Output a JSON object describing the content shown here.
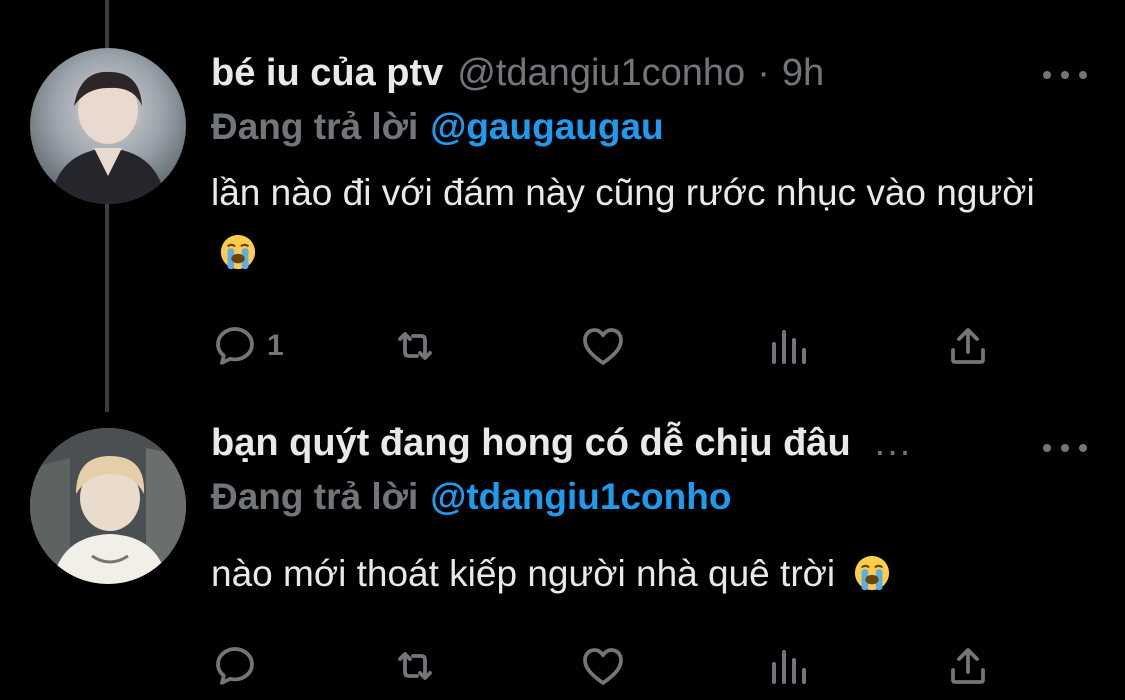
{
  "tweets": [
    {
      "display_name": "bé iu của ptv",
      "handle": "@tdangiu1conho",
      "separator": "·",
      "time": "9h",
      "reply_label": "Đang trả lời",
      "reply_to": "@gaugaugau",
      "text": "lần nào đi với đám này cũng rước nhục vào người",
      "text_emoji": "loudly-crying-face",
      "reply_count": "1"
    },
    {
      "display_name": "bạn quýt đang hong có dễ chịu đâu",
      "truncation": "...",
      "reply_label": "Đang trả lời",
      "reply_to": "@tdangiu1conho",
      "text": "nào mới thoát kiếp người nhà quê trời",
      "text_emoji": "loudly-crying-face"
    }
  ],
  "colors": {
    "background": "#000000",
    "text": "#e7e9ea",
    "muted": "#71767b",
    "accent": "#1d9bf0",
    "thread_line": "#3a3e42"
  },
  "icons": [
    "reply-icon",
    "retweet-icon",
    "like-icon",
    "views-icon",
    "share-icon",
    "more-icon"
  ]
}
